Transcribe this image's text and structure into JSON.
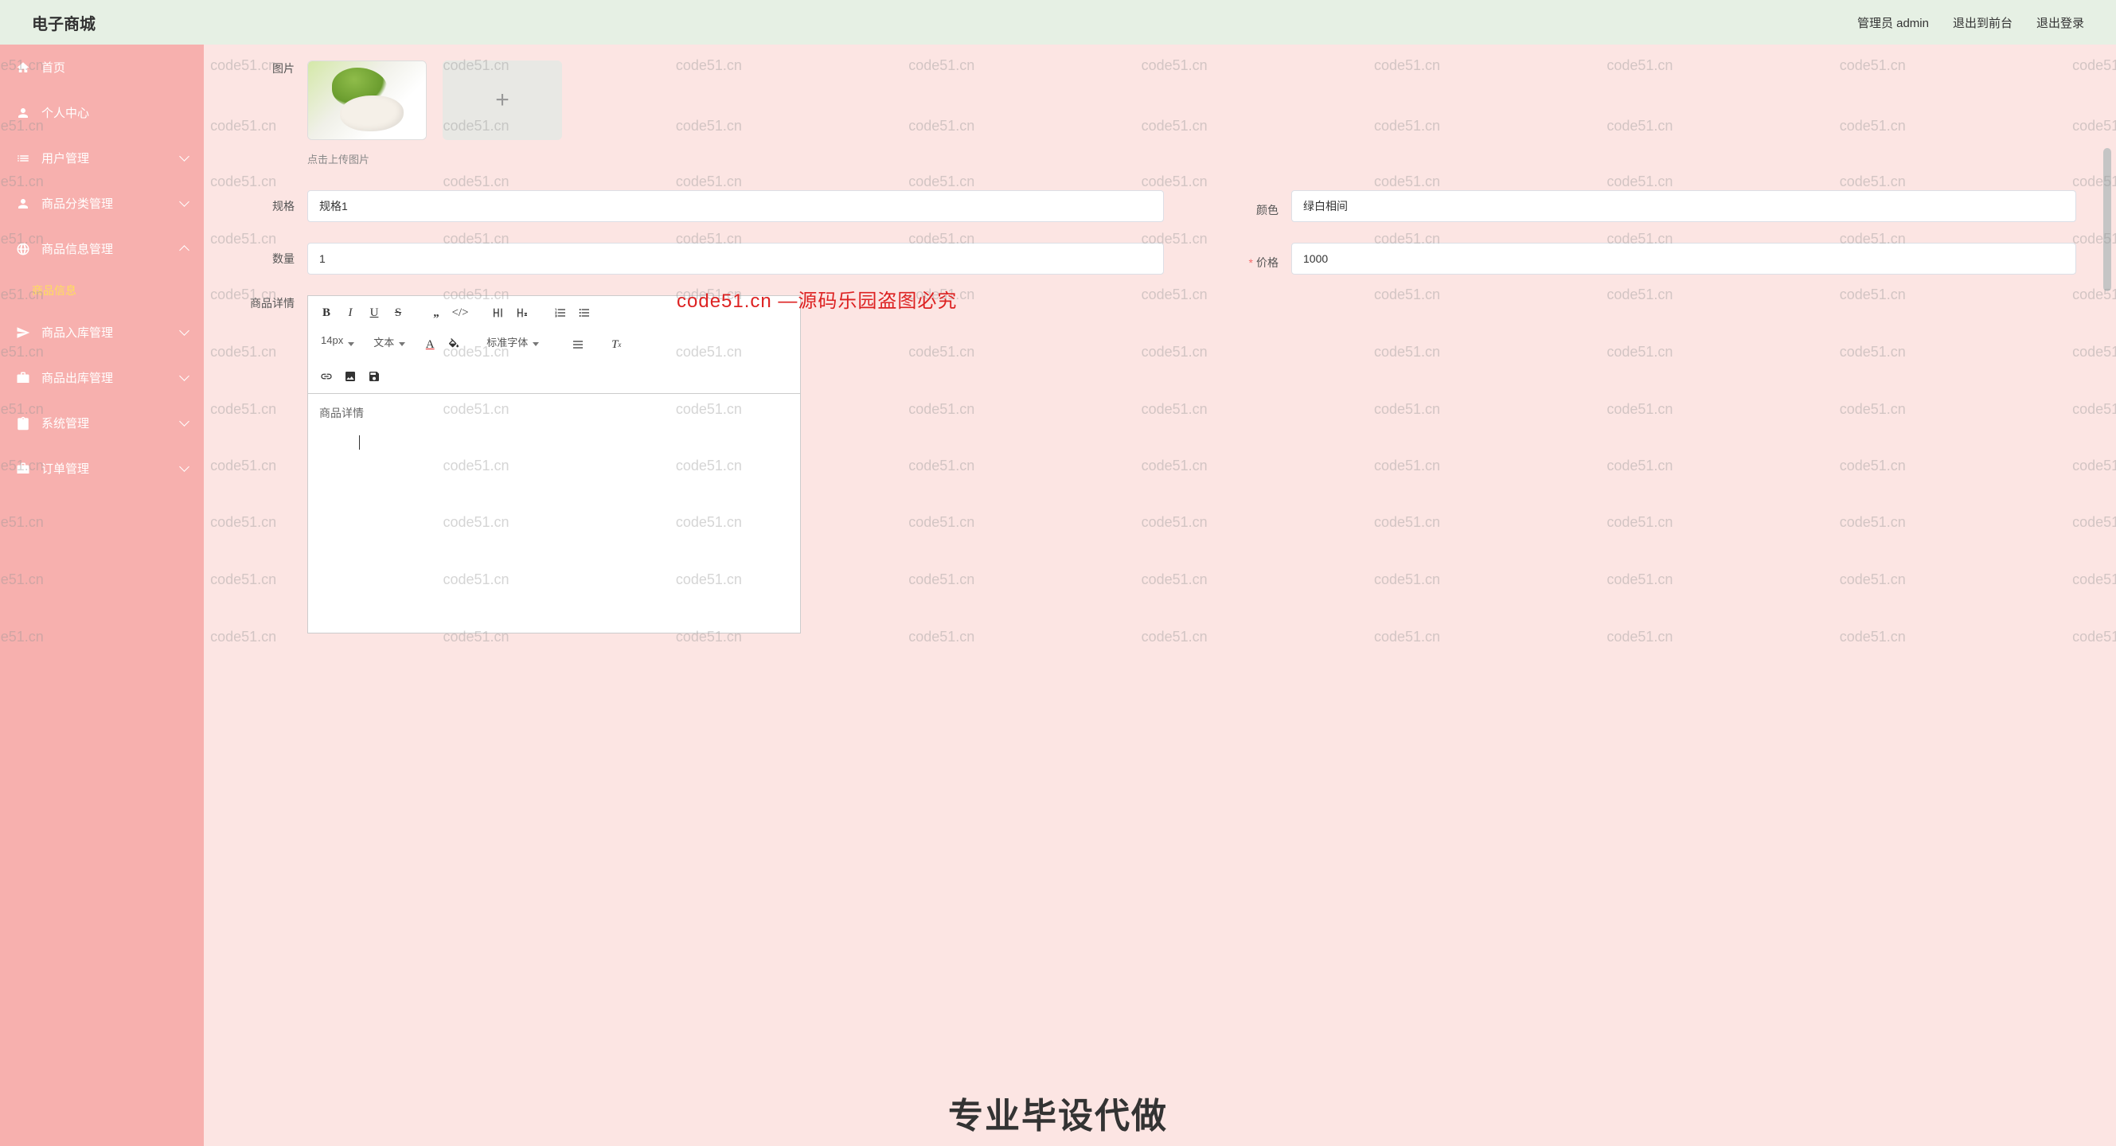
{
  "header": {
    "title": "电子商城",
    "user_label": "管理员 admin",
    "logout_front": "退出到前台",
    "logout": "退出登录"
  },
  "sidebar": {
    "home": "首页",
    "personal": "个人中心",
    "user_mgmt": "用户管理",
    "category_mgmt": "商品分类管理",
    "product_mgmt": "商品信息管理",
    "product_info": "商品信息",
    "stock_in": "商品入库管理",
    "stock_out": "商品出库管理",
    "system_mgmt": "系统管理",
    "order_mgmt": "订单管理"
  },
  "form": {
    "image_label": "图片",
    "upload_hint": "点击上传图片",
    "spec_label": "规格",
    "spec_value": "规格1",
    "color_label": "颜色",
    "color_value": "绿白相间",
    "qty_label": "数量",
    "qty_value": "1",
    "price_label": "价格",
    "price_value": "1000",
    "detail_label": "商品详情"
  },
  "editor": {
    "fontsize": "14px",
    "format": "文本",
    "fontfamily": "标准字体",
    "placeholder": "商品详情"
  },
  "watermark": "code51.cn",
  "overlay": {
    "red": "code51.cn —源码乐园盗图必究",
    "black": "专业毕设代做"
  }
}
